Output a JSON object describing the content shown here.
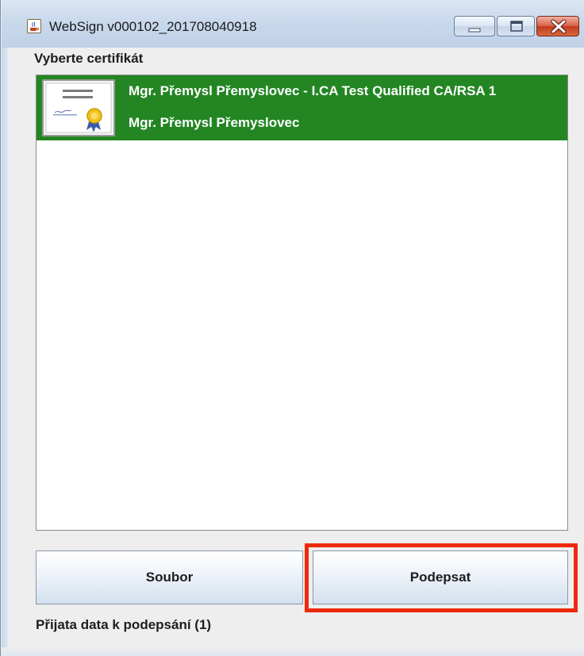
{
  "window": {
    "title": "WebSign v000102_201708040918",
    "icon": "java-cup-icon",
    "controls": [
      "minimize-icon",
      "maximize-icon",
      "close-icon"
    ],
    "close_color": "#c23b1f"
  },
  "prompt": {
    "label": "Vyberte certifikát"
  },
  "certificates": {
    "selected_color": "#238623",
    "items": [
      {
        "line1": "Mgr. Přemysl Přemyslovec - I.CA Test Qualified CA/RSA 1",
        "line2": "Mgr. Přemysl Přemyslovec",
        "icon": "certificate-icon",
        "selected": true
      }
    ]
  },
  "buttons": {
    "file_label": "Soubor",
    "sign_label": "Podepsat",
    "highlight_color": "#ee2a0e"
  },
  "status": {
    "text": "Přijata data k podepsání (1)"
  }
}
